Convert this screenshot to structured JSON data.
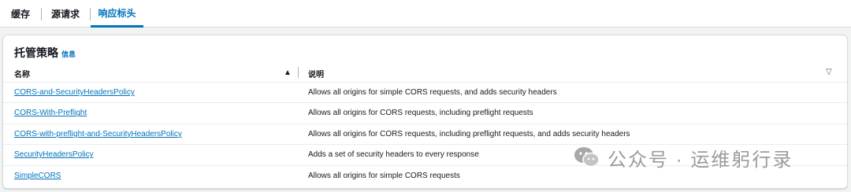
{
  "tabs": [
    {
      "label": "缓存",
      "active": false
    },
    {
      "label": "源请求",
      "active": false
    },
    {
      "label": "响应标头",
      "active": true
    }
  ],
  "panel": {
    "title": "托管策略",
    "info_label": "信息",
    "columns": {
      "name": "名称",
      "description": "说明"
    },
    "sort": "ascending",
    "rows": [
      {
        "name": "CORS-and-SecurityHeadersPolicy",
        "description": "Allows all origins for simple CORS requests, and adds security headers"
      },
      {
        "name": "CORS-With-Preflight",
        "description": "Allows all origins for CORS requests, including preflight requests"
      },
      {
        "name": "CORS-with-preflight-and-SecurityHeadersPolicy",
        "description": "Allows all origins for CORS requests, including preflight requests, and adds security headers"
      },
      {
        "name": "SecurityHeadersPolicy",
        "description": "Adds a set of security headers to every response"
      },
      {
        "name": "SimpleCORS",
        "description": "Allows all origins for simple CORS requests"
      }
    ]
  },
  "watermark": {
    "text": "公众号 · 运维躬行录",
    "icon": "wechat-icon"
  },
  "colors": {
    "link": "#0073bb",
    "text": "#16191f",
    "border": "#d5dbdb",
    "background": "#f2f3f3"
  }
}
